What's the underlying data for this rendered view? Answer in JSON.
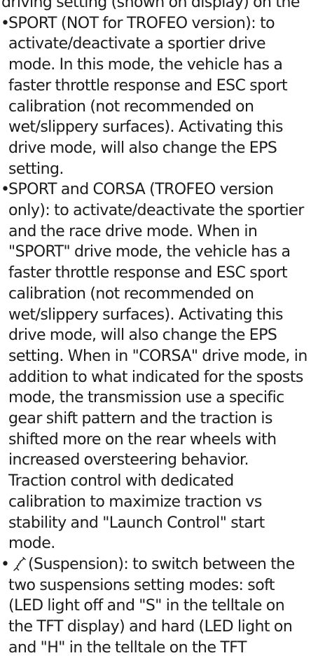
{
  "clipped_top_text": "driving setting (shown on display) on the",
  "bullets": [
    {
      "prefix": "",
      "text": "SPORT (NOT for TROFEO version): to activate/deactivate a sportier drive mode. In this mode, the vehicle has a faster throttle response and ESC sport calibration (not recommended on wet/slippery surfaces). Activating this drive mode, will also change the EPS setting."
    },
    {
      "prefix": "",
      "text": "SPORT and CORSA (TROFEO version only): to activate/deactivate the sportier and the race drive mode. When in \"SPORT\" drive mode, the vehicle has a faster throttle response and ESC sport calibration (not recommended on wet/slippery surfaces). Activating this drive mode, will also change the EPS setting. When in \"CORSA\" drive mode, in addition to what indicated for the sposts mode, the transmission use a specific gear shift pattern and the traction is shifted more on the rear wheels with increased oversteering behavior. Traction control with dedicated calibration to maximize traction vs stability and \"Launch Control\" start mode."
    },
    {
      "icon": "suspension-icon",
      "text": "(Suspension): to switch between the two suspensions setting modes: soft (LED light off and \"S\" in the telltale on the TFT display) and hard (LED light on and \"H\" in the telltale on the TFT"
    }
  ],
  "bullet_symbol": "•"
}
